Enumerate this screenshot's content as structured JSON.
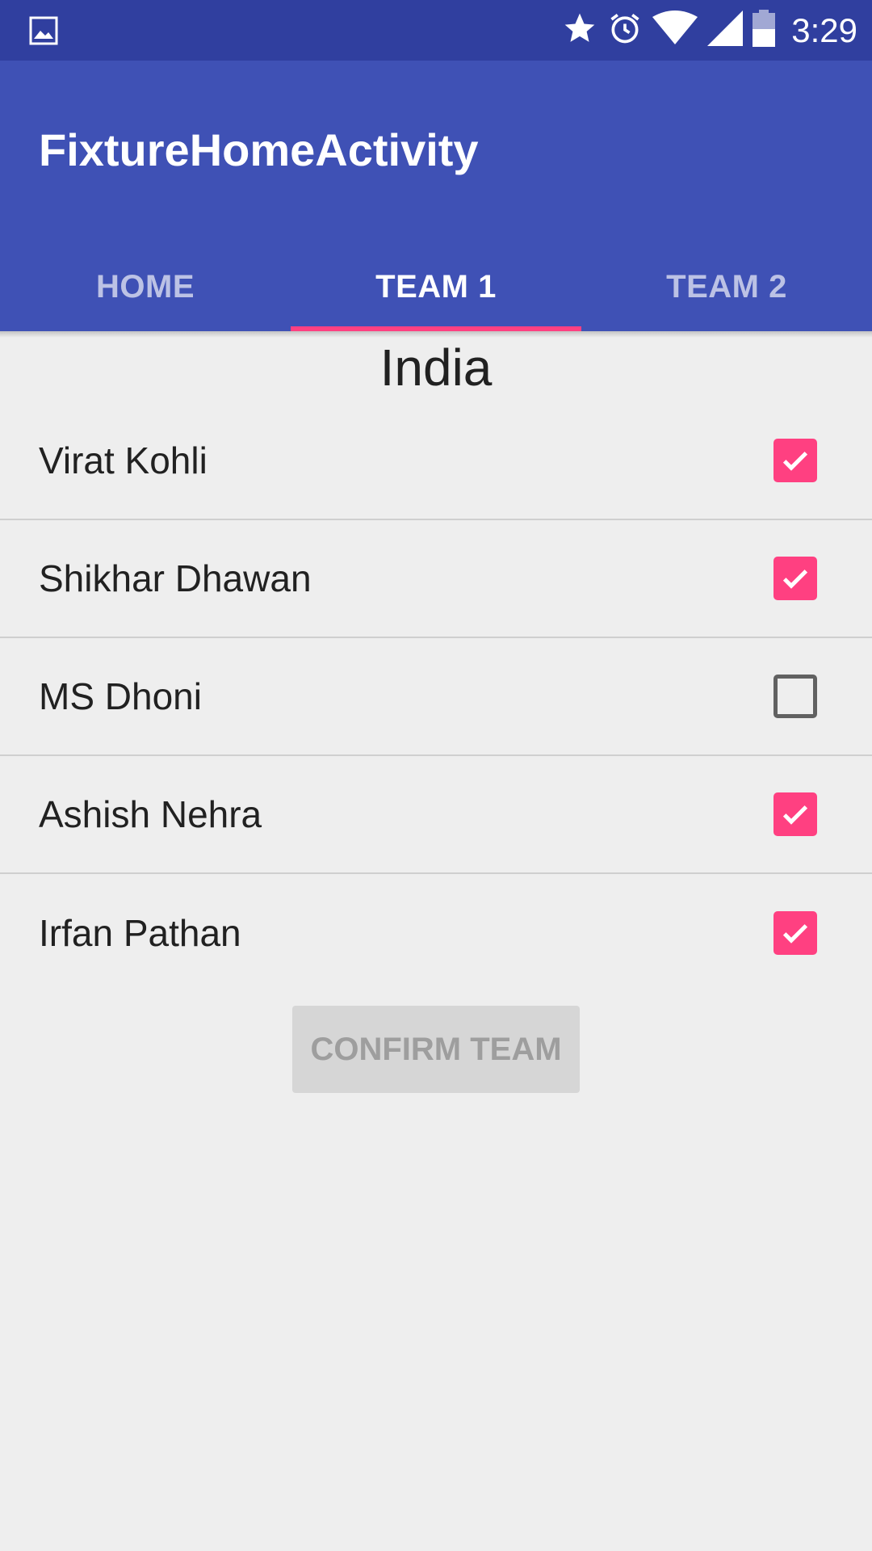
{
  "status_bar": {
    "time": "3:29",
    "icons": [
      "image-notification-icon",
      "star-icon",
      "alarm-icon",
      "wifi-icon",
      "signal-icon",
      "battery-icon"
    ]
  },
  "app_bar": {
    "title": "FixtureHomeActivity",
    "color": "#3f51b5",
    "tabs": [
      {
        "label": "HOME",
        "active": false
      },
      {
        "label": "TEAM 1",
        "active": true
      },
      {
        "label": "TEAM 2",
        "active": false
      }
    ],
    "indicator_color": "#ff4081"
  },
  "team": {
    "name": "India",
    "players": [
      {
        "name": "Virat Kohli",
        "checked": true
      },
      {
        "name": "Shikhar Dhawan",
        "checked": true
      },
      {
        "name": "MS Dhoni",
        "checked": false
      },
      {
        "name": "Ashish Nehra",
        "checked": true
      },
      {
        "name": "Irfan Pathan",
        "checked": true
      }
    ]
  },
  "actions": {
    "confirm_label": "CONFIRM TEAM",
    "confirm_enabled": false
  }
}
